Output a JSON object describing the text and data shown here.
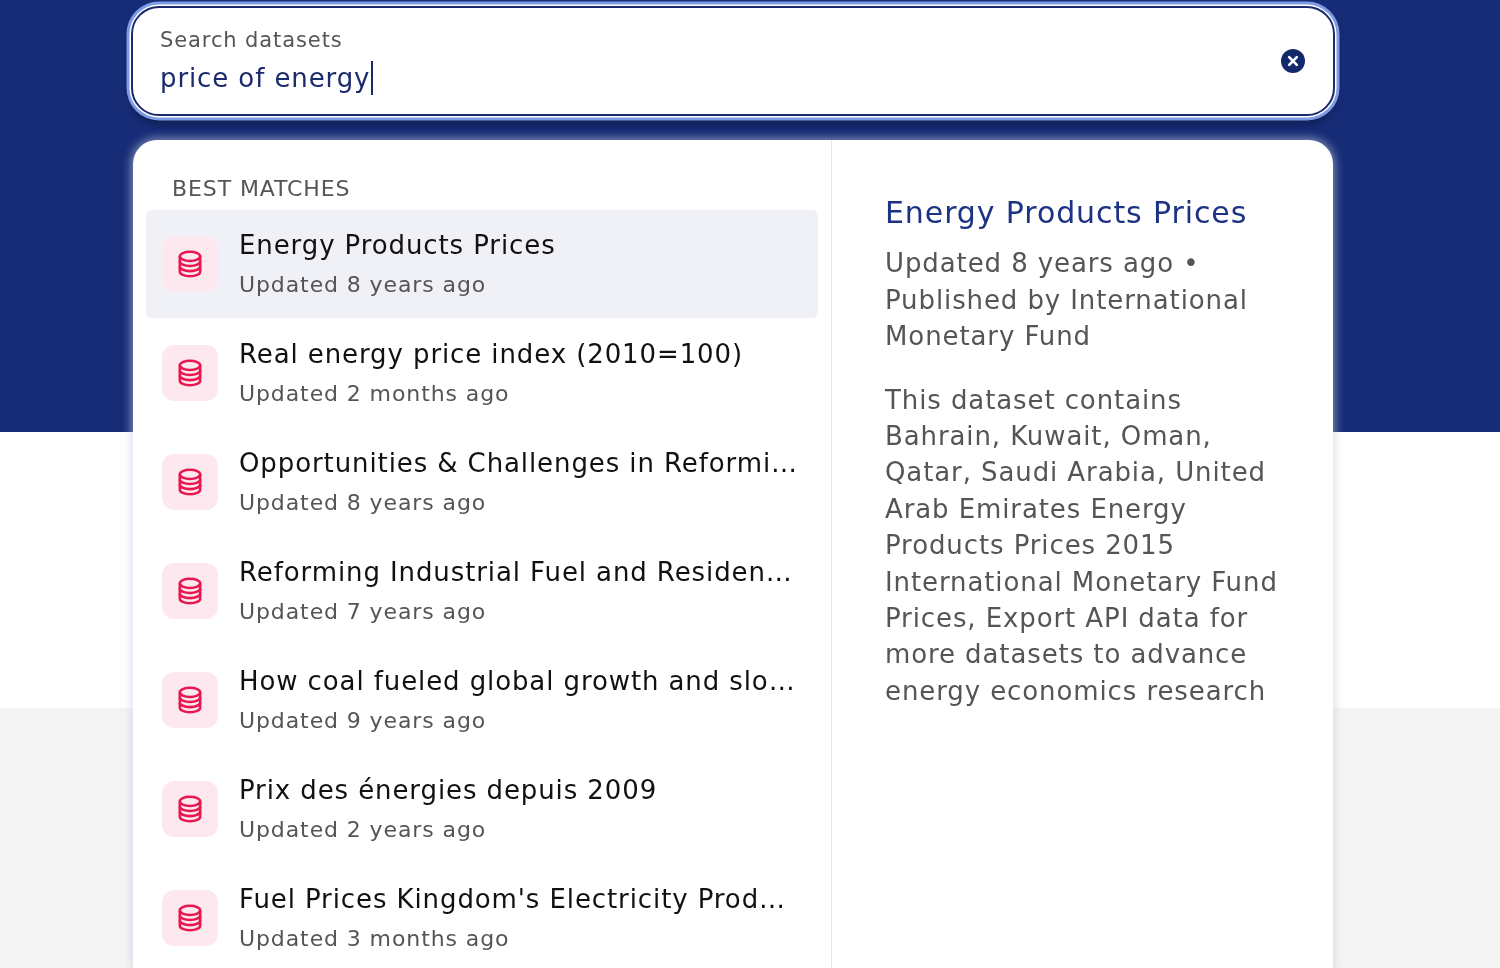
{
  "search": {
    "label": "Search datasets",
    "value": "price of energy"
  },
  "results": {
    "heading": "BEST MATCHES",
    "items": [
      {
        "title": "Energy Products Prices",
        "updated": "Updated 8 years ago",
        "selected": true
      },
      {
        "title": "Real energy price index (2010=100)",
        "updated": "Updated 2 months ago",
        "selected": false
      },
      {
        "title": "Opportunities & Challenges in Reformi…",
        "updated": "Updated 8 years ago",
        "selected": false
      },
      {
        "title": "Reforming Industrial Fuel and Residen…",
        "updated": "Updated 7 years ago",
        "selected": false
      },
      {
        "title": "How coal fueled global growth and slo…",
        "updated": "Updated 9 years ago",
        "selected": false
      },
      {
        "title": "Prix des énergies depuis 2009",
        "updated": "Updated 2 years ago",
        "selected": false
      },
      {
        "title": "Fuel Prices Kingdom's Electricity Prod…",
        "updated": "Updated 3 months ago",
        "selected": false
      }
    ]
  },
  "preview": {
    "title": "Energy Products Prices",
    "meta": "Updated 8 years ago • Published by International Monetary Fund",
    "description": "This dataset contains Bahrain, Kuwait, Oman, Qatar, Saudi Arabia, United Arab Emirates Energy Products Prices 2015 International Monetary Fund Prices, Export API data for more datasets to advance energy economics research"
  }
}
